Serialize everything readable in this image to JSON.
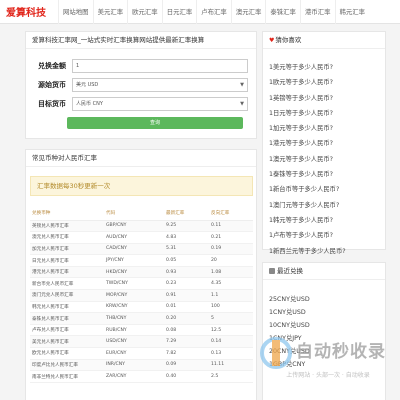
{
  "header": {
    "logo": "爱算科技",
    "nav": [
      "网站地图",
      "美元汇率",
      "欧元汇率",
      "日元汇率",
      "卢布汇率",
      "澳元汇率",
      "泰铢汇率",
      "港币汇率",
      "韩元汇率"
    ]
  },
  "converter": {
    "title": "爱算科技汇率网_一站式实时汇率换算网站提供最新汇率换算",
    "amount_label": "兑换金额",
    "amount_value": "1",
    "source_label": "源始货币",
    "source_value": "美元 USD",
    "target_label": "目标货币",
    "target_value": "人民币 CNY",
    "submit_label": "查询"
  },
  "rates": {
    "title": "常见币种对人民币汇率",
    "notice": "汇率数据每30秒更新一次",
    "columns": [
      "兑换币种",
      "代码",
      "最新汇率",
      "反向汇率"
    ],
    "rows": [
      [
        "英镑兑人民币汇率",
        "GBP/CNY",
        "9.25",
        "0.11"
      ],
      [
        "澳元兑人民币汇率",
        "AUD/CNY",
        "4.83",
        "0.21"
      ],
      [
        "加元兑人民币汇率",
        "CAD/CNY",
        "5.31",
        "0.19"
      ],
      [
        "日元兑人民币汇率",
        "JPY/CNY",
        "0.05",
        "20"
      ],
      [
        "港元兑人民币汇率",
        "HKD/CNY",
        "0.93",
        "1.08"
      ],
      [
        "新台币兑人民币汇率",
        "TWD/CNY",
        "0.23",
        "4.35"
      ],
      [
        "澳门元兑人民币汇率",
        "MOP/CNY",
        "0.91",
        "1.1"
      ],
      [
        "韩元兑人民币汇率",
        "KRW/CNY",
        "0.01",
        "100"
      ],
      [
        "泰铢兑人民币汇率",
        "THB/CNY",
        "0.20",
        "5"
      ],
      [
        "卢布兑人民币汇率",
        "RUB/CNY",
        "0.08",
        "12.5"
      ],
      [
        "美元兑人民币汇率",
        "USD/CNY",
        "7.29",
        "0.14"
      ],
      [
        "欧元兑人民币汇率",
        "EUR/CNY",
        "7.82",
        "0.13"
      ],
      [
        "印度卢比兑人民币汇率",
        "INR/CNY",
        "0.09",
        "11.11"
      ],
      [
        "南非兰特兑人民币汇率",
        "ZAR/CNY",
        "0.40",
        "2.5"
      ]
    ]
  },
  "favorites": {
    "title": "猜你喜欢",
    "items": [
      "1美元等于多少人民币?",
      "1欧元等于多少人民币?",
      "1英镑等于多少人民币?",
      "1日元等于多少人民币?",
      "1加元等于多少人民币?",
      "1港元等于多少人民币?",
      "1澳元等于多少人民币?",
      "1泰铢等于多少人民币?",
      "1新台币等于多少人民币?",
      "1澳门元等于多少人民币?",
      "1韩元等于多少人民币?",
      "1卢布等于多少人民币?",
      "1新西兰元等于多少人民币?",
      "1俄罗斯卢布等于多少人民币?"
    ]
  },
  "recent": {
    "title": "最近兑换",
    "items": [
      "25CNY兑USD",
      "1CNY兑USD",
      "10CNY兑USD",
      "1CNY兑JPY",
      "20CNY兑USD",
      "1GBP兑CNY"
    ]
  },
  "watermark": {
    "title": "自动秒收录",
    "subtitle": "上传网站 · 头部一次 · 自动收录"
  },
  "icons": {
    "select_chevron": "chevron-down-icon",
    "fav_heading": "heart-icon",
    "recent_heading": "fire-icon"
  }
}
